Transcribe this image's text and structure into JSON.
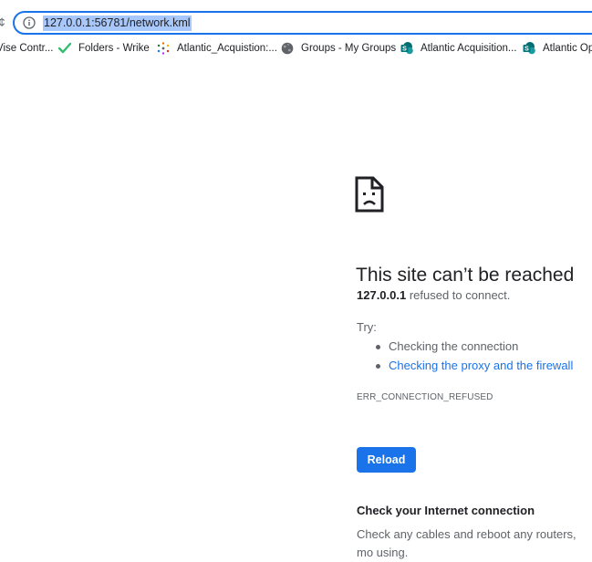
{
  "browser": {
    "nav_edge_glyph": "¢",
    "address_bar": {
      "url": "127.0.0.1:56781/network.kml",
      "info_icon": "info-icon"
    },
    "bookmarks": [
      {
        "label": "Vise Contr...",
        "icon": "page-icon"
      },
      {
        "label": "Folders - Wrike",
        "icon": "wrike-check-icon"
      },
      {
        "label": "Atlantic_Acquistion:...",
        "icon": "dots-burst-icon"
      },
      {
        "label": "Groups - My Groups",
        "icon": "globe-icon"
      },
      {
        "label": "Atlantic Acquisition...",
        "icon": "sharepoint-icon"
      },
      {
        "label": "Atlantic Op",
        "icon": "sharepoint-icon"
      }
    ]
  },
  "error_page": {
    "icon": "sad-page-icon",
    "title": "This site can’t be reached",
    "host": "127.0.0.1",
    "message_suffix": " refused to connect.",
    "try_label": "Try:",
    "suggestions": [
      {
        "text": "Checking the connection",
        "is_link": false
      },
      {
        "text": "Checking the proxy and the firewall",
        "is_link": true
      }
    ],
    "error_code": "ERR_CONNECTION_REFUSED",
    "reload_label": "Reload",
    "details_heading": "Check your Internet connection",
    "details_body": "Check any cables and reboot any routers, mo using."
  },
  "colors": {
    "accent": "#1a73e8",
    "url_highlight": "#a8c7fa",
    "wrike_green": "#2fbf71",
    "sharepoint_teal": "#038387"
  }
}
